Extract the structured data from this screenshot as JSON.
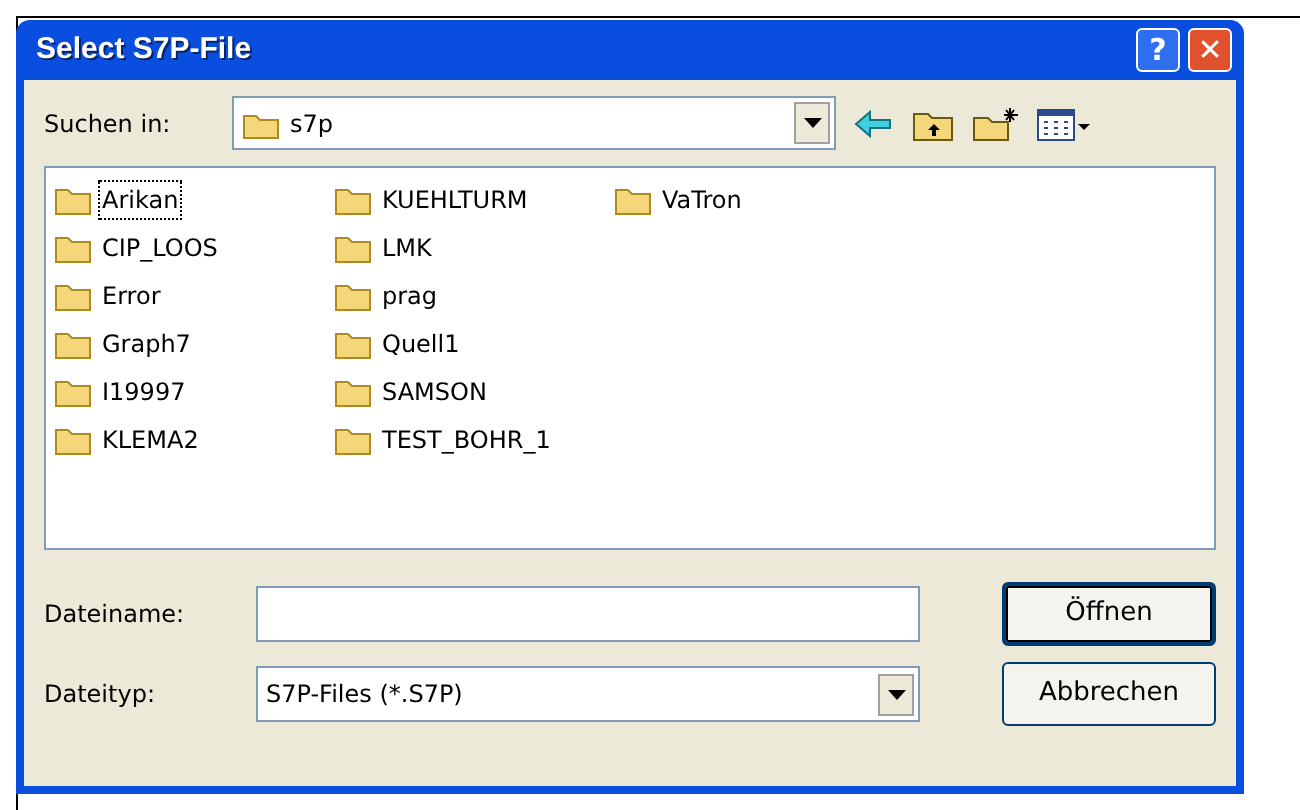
{
  "window": {
    "title": "Select S7P-File",
    "buttons": [
      "?",
      "✕"
    ]
  },
  "look_in": {
    "label": "Suchen in:",
    "value": "s7p"
  },
  "folders": [
    {
      "name": "Arikan",
      "selected": true
    },
    {
      "name": "CIP_LOOS",
      "selected": false
    },
    {
      "name": "Error",
      "selected": false
    },
    {
      "name": "Graph7",
      "selected": false
    },
    {
      "name": "I19997",
      "selected": false
    },
    {
      "name": "KLEMA2",
      "selected": false
    },
    {
      "name": "KUEHLTURM",
      "selected": false
    },
    {
      "name": "LMK",
      "selected": false
    },
    {
      "name": "prag",
      "selected": false
    },
    {
      "name": "Quell1",
      "selected": false
    },
    {
      "name": "SAMSON",
      "selected": false
    },
    {
      "name": "TEST_BOHR_1",
      "selected": false
    },
    {
      "name": "VaTron",
      "selected": false
    }
  ],
  "file_name": {
    "label": "Dateiname:"
  },
  "file_type": {
    "label": "Dateityp:",
    "value": "S7P-Files (*.S7P)"
  },
  "buttons": [
    {
      "label": "Öffnen",
      "default": true
    },
    {
      "label": "Abbrechen",
      "default": false
    }
  ]
}
